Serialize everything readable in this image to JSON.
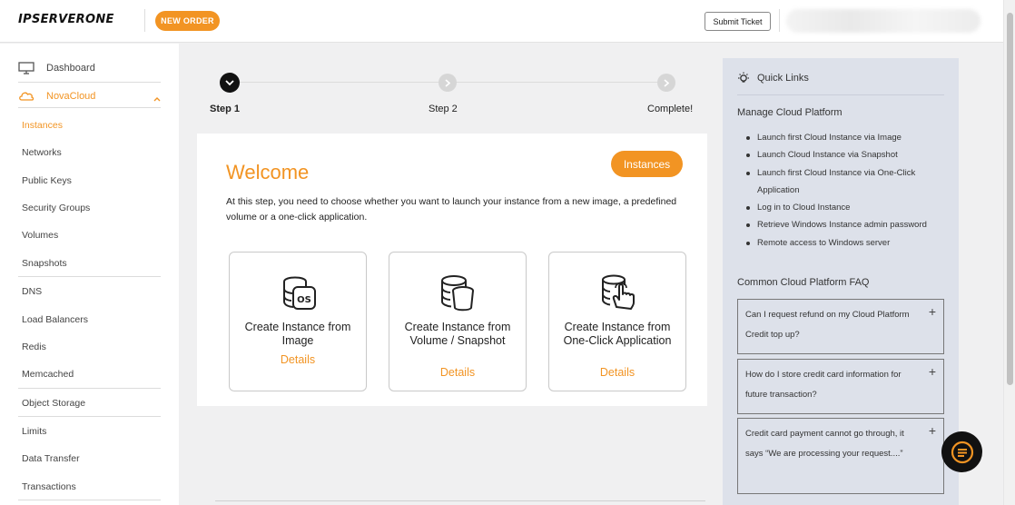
{
  "header": {
    "logo": "IPSERVERONE",
    "new_order": "NEW ORDER",
    "submit_ticket": "Submit Ticket"
  },
  "sidebar": {
    "dashboard": "Dashboard",
    "novacloud": "NovaCloud",
    "items": [
      {
        "label": "Instances",
        "active": true
      },
      {
        "label": "Networks"
      },
      {
        "label": "Public Keys"
      },
      {
        "label": "Security Groups"
      },
      {
        "label": "Volumes"
      },
      {
        "label": "Snapshots"
      },
      {
        "label": "DNS"
      },
      {
        "label": "Load Balancers"
      },
      {
        "label": "Redis"
      },
      {
        "label": "Memcached"
      },
      {
        "label": "Object Storage"
      },
      {
        "label": "Limits"
      },
      {
        "label": "Data Transfer"
      },
      {
        "label": "Transactions"
      }
    ]
  },
  "stepper": {
    "steps": [
      {
        "label": "Step 1",
        "state": "done"
      },
      {
        "label": "Step 2",
        "state": "todo"
      },
      {
        "label": "Complete!",
        "state": "todo"
      }
    ]
  },
  "main": {
    "welcome": "Welcome",
    "instances_button": "Instances",
    "intro": "At this step, you need to choose whether you want to launch your instance from a new image, a predefined volume or a one-click application.",
    "options": [
      {
        "title": "Create Instance from Image",
        "link": "Details",
        "icon": "image-os-icon"
      },
      {
        "title": "Create Instance from Volume / Snapshot",
        "link": "Details",
        "icon": "volume-snapshot-icon"
      },
      {
        "title": "Create Instance from One-Click Application",
        "link": "Details",
        "icon": "one-click-app-icon"
      }
    ]
  },
  "quick_links": {
    "title": "Quick Links",
    "manage_heading": "Manage Cloud Platform",
    "links": [
      "Launch first Cloud Instance via Image",
      "Launch Cloud Instance via Snapshot",
      "Launch first Cloud Instance via One-Click Application",
      "Log in to Cloud Instance",
      "Retrieve Windows Instance admin password",
      "Remote access to Windows server"
    ],
    "faq_heading": "Common Cloud Platform FAQ",
    "faqs": [
      "Can I request refund on my Cloud Platform Credit top up?",
      "How do I store credit card information for future transaction?",
      "Credit card payment cannot go through, it says “We are processing your request....”"
    ]
  },
  "colors": {
    "accent": "#f29423",
    "panel": "#dde1ea",
    "dark": "#111111"
  }
}
